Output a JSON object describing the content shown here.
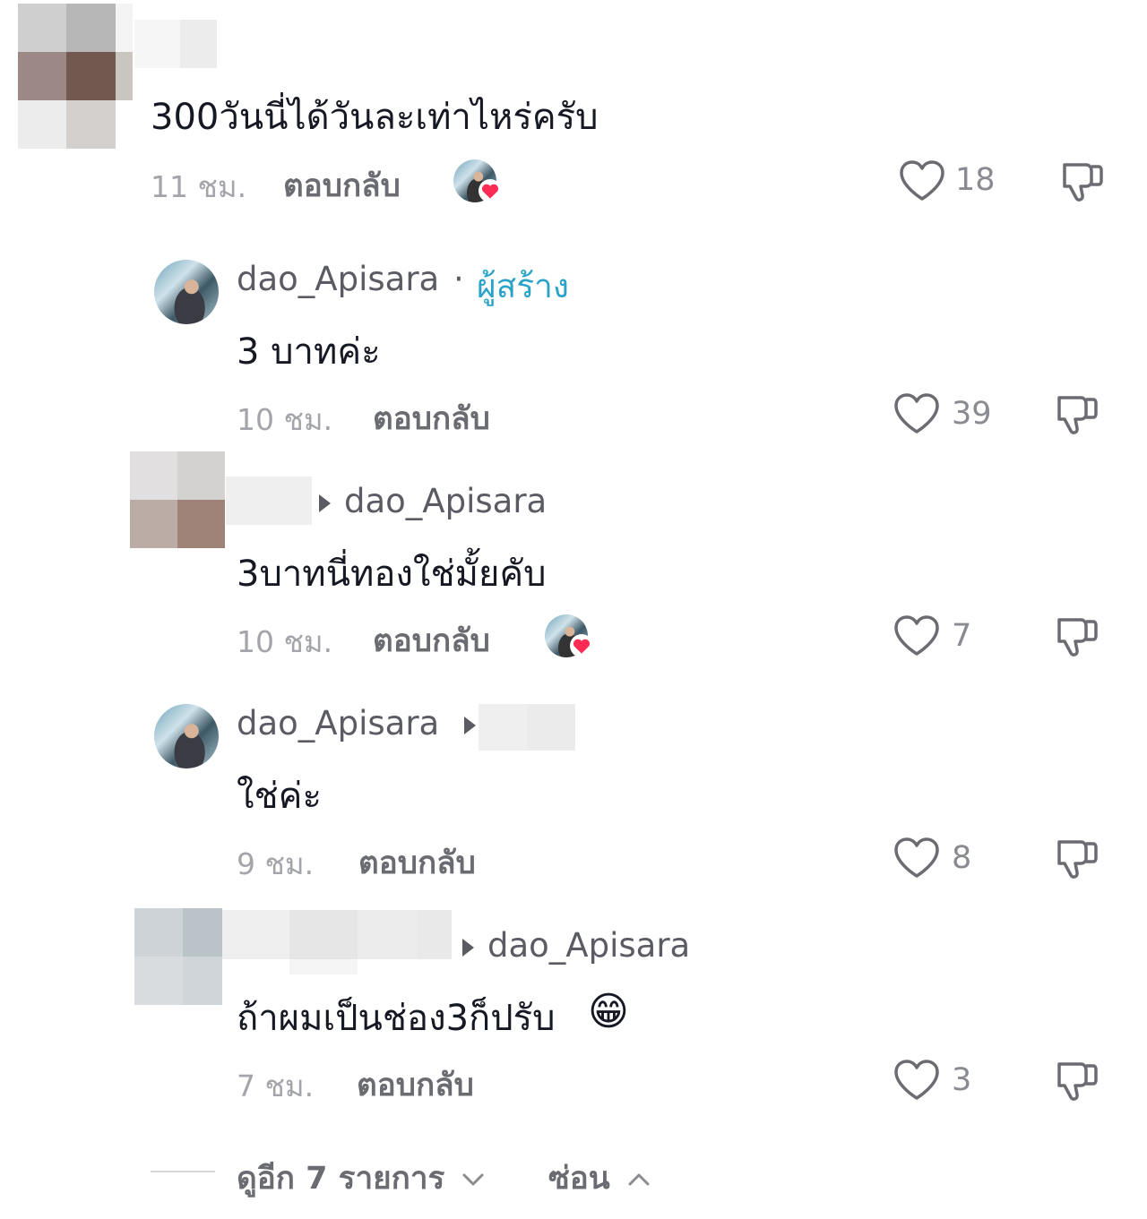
{
  "colors": {
    "accent_creator": "#2aa3c9",
    "text": "#161823",
    "meta": "#a4a5aa",
    "heart_badge": "#fe2c55"
  },
  "comments": [
    {
      "text": "300วันนี่ได้วันละเท่าไหร่ครับ",
      "time": "11 ชม.",
      "reply_label": "ตอบกลับ",
      "likes": "18",
      "creator_liked": true
    },
    {
      "username": "dao_Apisara",
      "separator": "·",
      "badge": "ผู้สร้าง",
      "text": "3 บาทค่ะ",
      "time": "10 ชม.",
      "reply_label": "ตอบกลับ",
      "likes": "39"
    },
    {
      "reply_to": "dao_Apisara",
      "text": "3บาทนี่ทองใช่มั้ยคับ",
      "time": "10 ชม.",
      "reply_label": "ตอบกลับ",
      "likes": "7",
      "creator_liked": true
    },
    {
      "username": "dao_Apisara",
      "text": "ใช่ค่ะ",
      "time": "9 ชม.",
      "reply_label": "ตอบกลับ",
      "likes": "8"
    },
    {
      "reply_to": "dao_Apisara",
      "text": "ถ้าผมเป็นช่อง3ก็ปรับ",
      "emoji": "😁",
      "time": "7 ชม.",
      "reply_label": "ตอบกลับ",
      "likes": "3"
    }
  ],
  "footer": {
    "view_more": "ดูอีก 7 รายการ",
    "hide": "ซ่อน"
  },
  "icons": {
    "like": "heart-outline-icon",
    "dislike": "thumbs-down-icon",
    "expand": "chevron-down-icon",
    "collapse": "chevron-up-icon",
    "arrow": "caret-right-icon"
  }
}
